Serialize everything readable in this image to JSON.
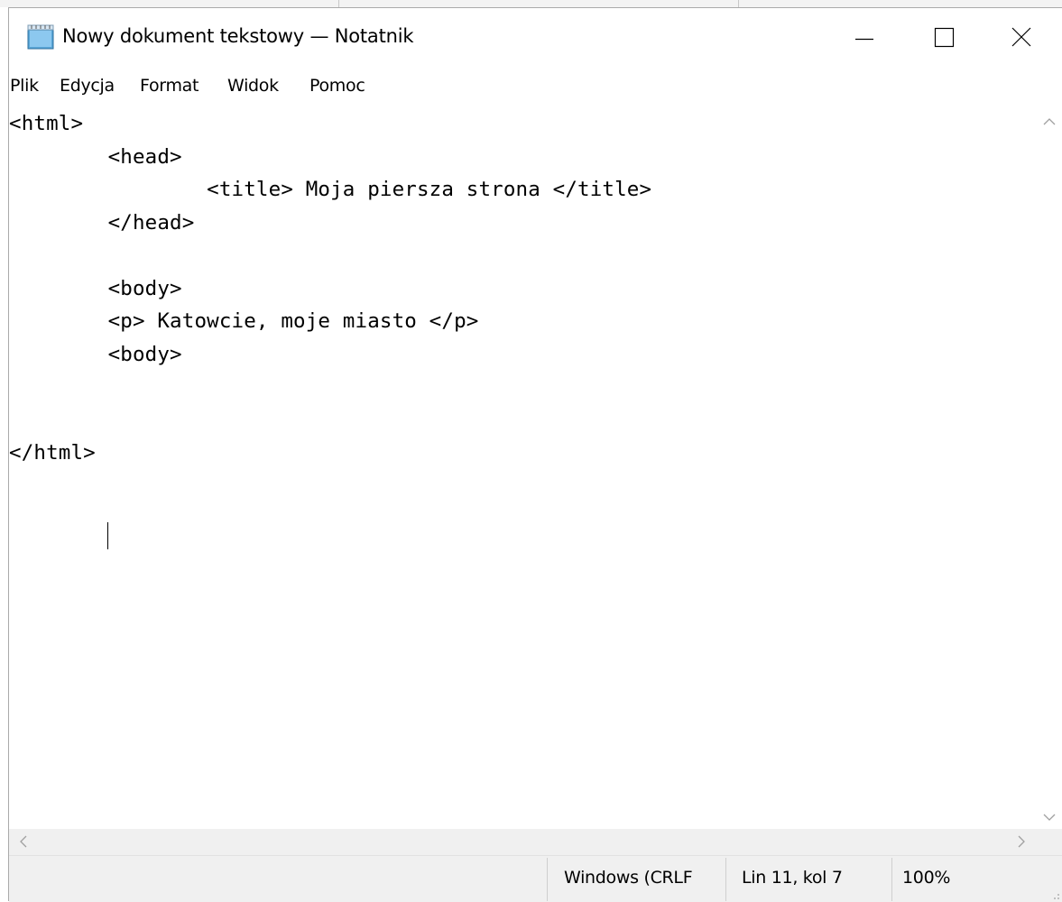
{
  "window": {
    "title": "Nowy dokument tekstowy — Notatnik",
    "controls": {
      "minimize": "minimize",
      "maximize": "maximize",
      "close": "close"
    }
  },
  "menu": {
    "items": [
      "Plik",
      "Edycja",
      "Format",
      "Widok",
      "Pomoc"
    ]
  },
  "editor": {
    "content": "<html>\n\t<head>\n\t\t<title> Moja piersza strona </title>\n\t</head>\n\n\t<body>\n\t<p> Katowcie, moje miasto </p>\n\t<body>\n\n\n</html>",
    "caret": {
      "line": 11,
      "column": 7
    }
  },
  "status": {
    "line_endings": "Windows (CRLF",
    "position": "Lin 11, kol 7",
    "zoom": "100%"
  },
  "icons": {
    "app": "notepad-icon",
    "minimize": "minimize-icon",
    "maximize": "maximize-icon",
    "close": "close-icon",
    "scroll_up": "chevron-up-icon",
    "scroll_down": "chevron-down-icon",
    "scroll_left": "chevron-left-icon",
    "scroll_right": "chevron-right-icon"
  },
  "colors": {
    "window_bg": "#ffffff",
    "status_bg": "#f0f0f0",
    "text": "#000000"
  }
}
